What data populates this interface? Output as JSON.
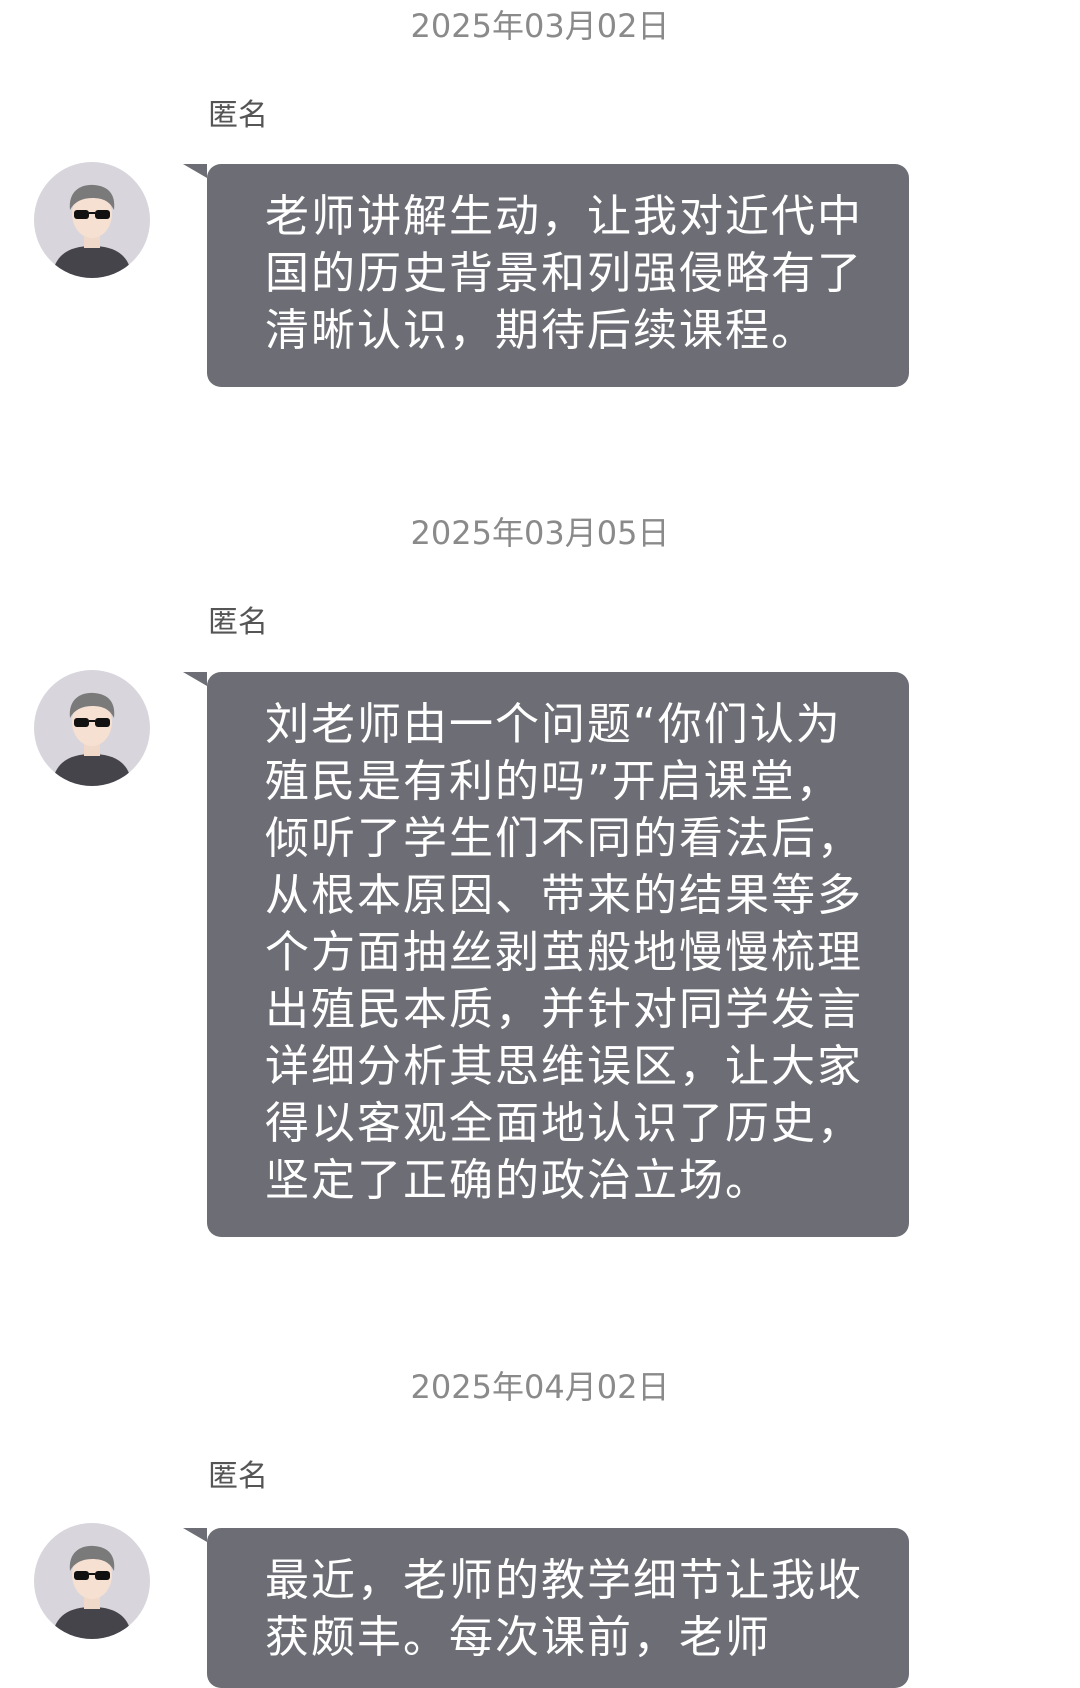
{
  "messages": [
    {
      "date": "2025年03月02日",
      "sender": "匿名",
      "text": "老师讲解生动，让我对近代中国的历史背景和列强侵略有了清晰认识，期待后续课程。"
    },
    {
      "date": "2025年03月05日",
      "sender": "匿名",
      "text": "刘老师由一个问题“你们认为殖民是有利的吗”开启课堂，倾听了学生们不同的看法后，从根本原因、带来的结果等多个方面抽丝剥茧般地慢慢梳理出殖民本质，并针对同学发言详细分析其思维误区，让大家得以客观全面地认识了历史，坚定了正确的政治立场。"
    },
    {
      "date": "2025年04月02日",
      "sender": "匿名",
      "text": "最近，老师的教学细节让我收获颇丰。每次课前，老师"
    }
  ],
  "colors": {
    "bubble": "#6d6e75",
    "date_text": "#8a8a8a",
    "sender_text": "#555555",
    "avatar_bg": "#d8d5dc"
  },
  "icons": {
    "avatar": "anonymous-avatar-sunglasses-icon"
  }
}
